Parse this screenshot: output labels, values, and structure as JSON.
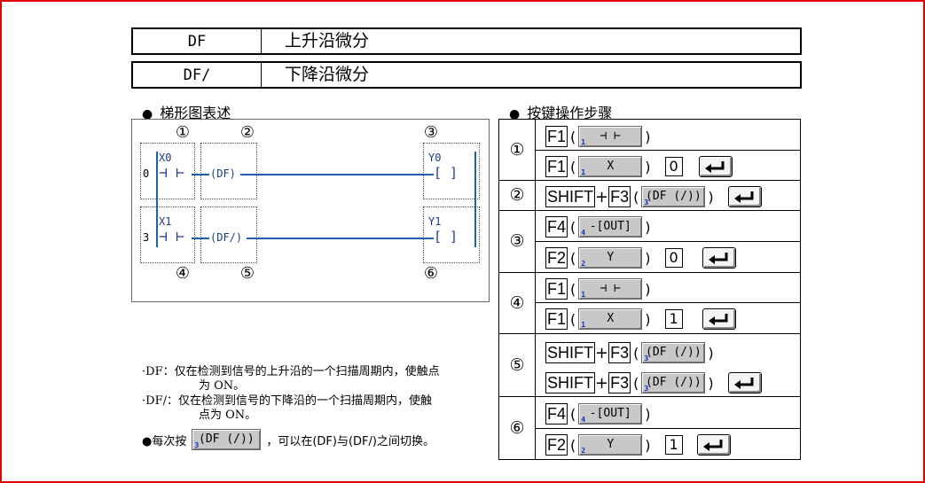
{
  "definitions": [
    {
      "code": "DF",
      "desc": "上升沿微分"
    },
    {
      "code": "DF/",
      "desc": "下降沿微分"
    }
  ],
  "ladder": {
    "heading": "梯形图表述",
    "circle_top": [
      "①",
      "②",
      "③"
    ],
    "circle_bottom": [
      "④",
      "⑤",
      "⑥"
    ],
    "rung1": {
      "step": "0",
      "contact": "X0",
      "instr": "(DF)",
      "coil": "Y0"
    },
    "rung2": {
      "step": "3",
      "contact": "X1",
      "instr": "(DF/)",
      "coil": "Y1"
    }
  },
  "notes": [
    {
      "bullet": "·",
      "line1": "DF：仅在检测到信号的上升沿的一个扫描周期内，使触点",
      "line2": "为 ON。"
    },
    {
      "bullet": "·",
      "line1": "DF/：仅在检测到信号的下降沿的一个扫描周期内，使触",
      "line2": "点为 ON。"
    }
  ],
  "tip": {
    "prefix": "●每次按",
    "key_label": "(DF (/))",
    "key_num": "3",
    "suffix": "，可以在(DF)与(DF/)之间切换。"
  },
  "keys": {
    "heading": "按键操作步骤",
    "steps": [
      {
        "num": "①"
      },
      {
        "num": "②"
      },
      {
        "num": "③"
      },
      {
        "num": "④"
      },
      {
        "num": "⑤"
      },
      {
        "num": "⑥"
      }
    ],
    "f1": "F1",
    "f2": "F2",
    "f3": "F3",
    "f4": "F4",
    "shift": "SHIFT",
    "plus": "+",
    "lp": "(",
    "rp": ")",
    "soft_contact": "⊣ ⊢",
    "soft_x": "X",
    "soft_y": "Y",
    "soft_out": "-[OUT]",
    "soft_df": "(DF (/))",
    "n1": "1",
    "n2": "2",
    "n3": "3",
    "n4": "4",
    "d0": "0",
    "d1": "1"
  },
  "colors": {
    "frame": "#e00000",
    "wire": "#2060b0",
    "softkey": "#c8c8c8"
  }
}
